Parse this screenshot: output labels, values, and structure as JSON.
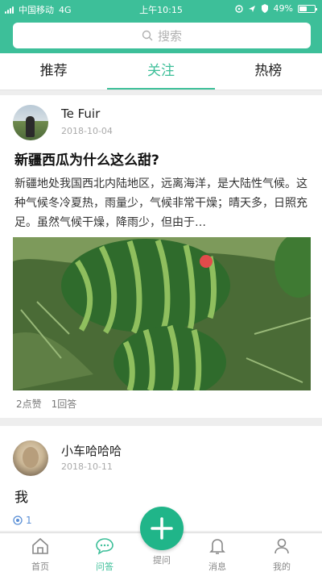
{
  "status_bar": {
    "carrier": "中国移动",
    "network": "4G",
    "time": "上午10:15",
    "battery": "49%",
    "battery_level": 0.49
  },
  "search": {
    "placeholder": "搜索"
  },
  "tabs": [
    {
      "label": "推荐",
      "active": false
    },
    {
      "label": "关注",
      "active": true
    },
    {
      "label": "热榜",
      "active": false
    }
  ],
  "feed": [
    {
      "author": "Te Fuir",
      "date": "2018-10-04",
      "title": "新疆西瓜为什么这么甜?",
      "excerpt": "新疆地处我国西北内陆地区，远离海洋，是大陆性气候。这种气候冬冷夏热，雨量少，气候非常干燥；晴天多，日照充足。虽然气候干燥，降雨少，但由于…",
      "likes": "2点赞",
      "answers": "1回答"
    },
    {
      "author": "小车哈哈哈",
      "date": "2018-10-11",
      "title": "我",
      "follow_count": "1"
    }
  ],
  "bottom_nav": [
    {
      "label": "首页",
      "icon": "home-icon",
      "active": false
    },
    {
      "label": "问答",
      "icon": "chat-icon",
      "active": true
    },
    {
      "label": "提问",
      "icon": "plus-icon",
      "active": false
    },
    {
      "label": "消息",
      "icon": "bell-icon",
      "active": false
    },
    {
      "label": "我的",
      "icon": "person-icon",
      "active": false
    }
  ],
  "colors": {
    "brand": "#3dbf99",
    "fab": "#20b589"
  }
}
